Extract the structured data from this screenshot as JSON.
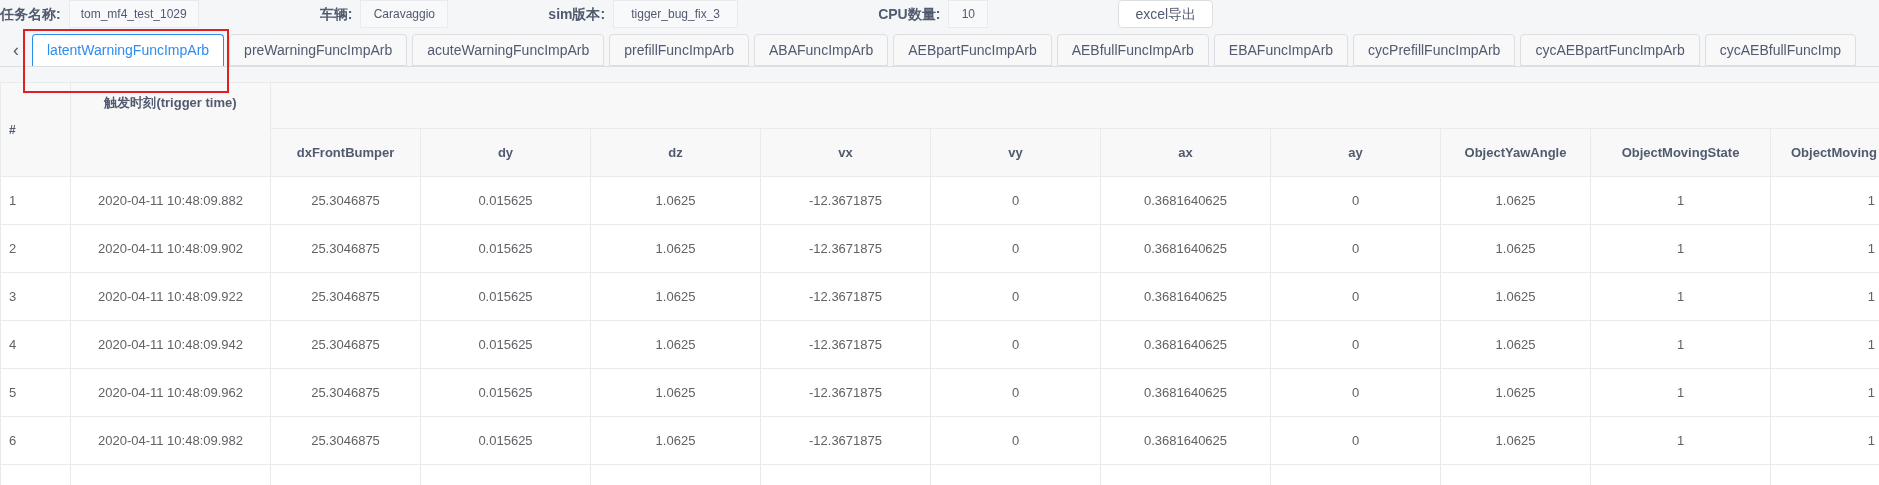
{
  "filters": [
    {
      "label": "任务名称:",
      "value": "tom_mf4_test_1029"
    },
    {
      "label": "车辆:",
      "value": "Caravaggio"
    },
    {
      "label": "sim版本:",
      "value": "tigger_bug_fix_3"
    },
    {
      "label": "CPU数量:",
      "value": "10"
    }
  ],
  "export_button": "excel导出",
  "tabs_prev": "‹",
  "tabs": [
    {
      "label": "latentWarningFuncImpArb",
      "selected": true
    },
    {
      "label": "preWarningFuncImpArb",
      "selected": false
    },
    {
      "label": "acuteWarningFuncImpArb",
      "selected": false
    },
    {
      "label": "prefillFuncImpArb",
      "selected": false
    },
    {
      "label": "ABAFuncImpArb",
      "selected": false
    },
    {
      "label": "AEBpartFuncImpArb",
      "selected": false
    },
    {
      "label": "AEBfullFuncImpArb",
      "selected": false
    },
    {
      "label": "EBAFuncImpArb",
      "selected": false
    },
    {
      "label": "cycPrefillFuncImpArb",
      "selected": false
    },
    {
      "label": "cycAEBpartFuncImpArb",
      "selected": false
    },
    {
      "label": "cycAEBfullFuncImp",
      "selected": false
    }
  ],
  "table": {
    "columns": [
      "#",
      "触发时刻(trigger time)",
      "dxFrontBumper",
      "dy",
      "dz",
      "vx",
      "vy",
      "ax",
      "ay",
      "ObjectYawAngle",
      "ObjectMovingState",
      "ObjectMoving"
    ],
    "rows": [
      [
        "1",
        "2020-04-11 10:48:09.882",
        "25.3046875",
        "0.015625",
        "1.0625",
        "-12.3671875",
        "0",
        "0.3681640625",
        "0",
        "1.0625",
        "1",
        "1"
      ],
      [
        "2",
        "2020-04-11 10:48:09.902",
        "25.3046875",
        "0.015625",
        "1.0625",
        "-12.3671875",
        "0",
        "0.3681640625",
        "0",
        "1.0625",
        "1",
        "1"
      ],
      [
        "3",
        "2020-04-11 10:48:09.922",
        "25.3046875",
        "0.015625",
        "1.0625",
        "-12.3671875",
        "0",
        "0.3681640625",
        "0",
        "1.0625",
        "1",
        "1"
      ],
      [
        "4",
        "2020-04-11 10:48:09.942",
        "25.3046875",
        "0.015625",
        "1.0625",
        "-12.3671875",
        "0",
        "0.3681640625",
        "0",
        "1.0625",
        "1",
        "1"
      ],
      [
        "5",
        "2020-04-11 10:48:09.962",
        "25.3046875",
        "0.015625",
        "1.0625",
        "-12.3671875",
        "0",
        "0.3681640625",
        "0",
        "1.0625",
        "1",
        "1"
      ],
      [
        "6",
        "2020-04-11 10:48:09.982",
        "25.3046875",
        "0.015625",
        "1.0625",
        "-12.3671875",
        "0",
        "0.3681640625",
        "0",
        "1.0625",
        "1",
        "1"
      ]
    ]
  }
}
